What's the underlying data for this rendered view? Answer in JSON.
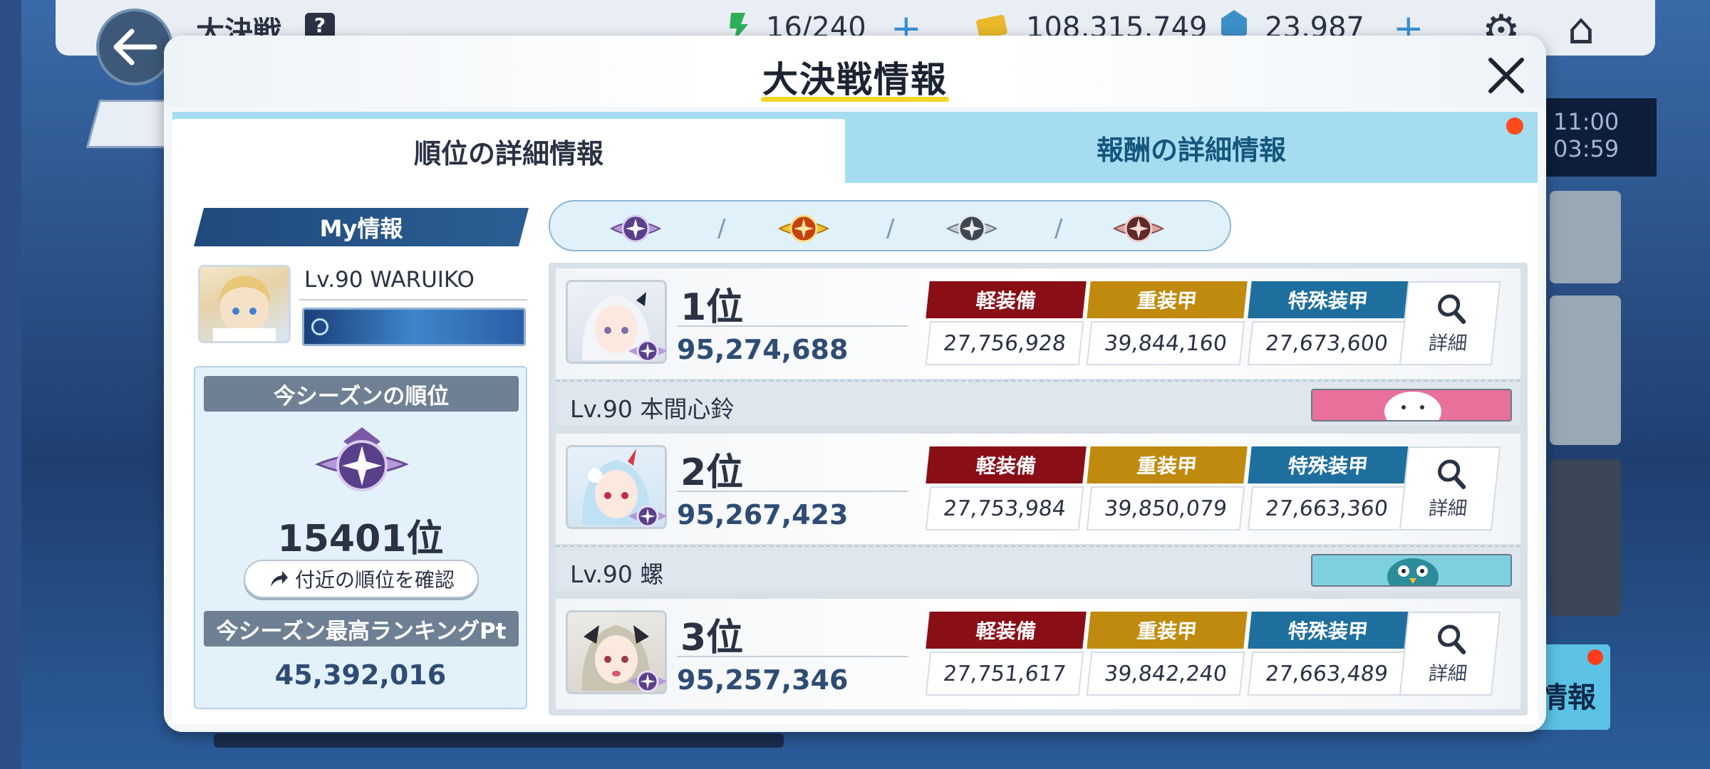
{
  "background": {
    "title": "大決戦",
    "help_label": "?",
    "stamina": "16/240",
    "credits": "108,315,749",
    "gems": "23,987",
    "side_label": "大",
    "timer_line1": "11:00",
    "timer_line2": "03:59",
    "info_label": "情報"
  },
  "modal": {
    "title": "大決戦情報",
    "tabs": {
      "rank": "順位の詳細情報",
      "reward": "報酬の詳細情報"
    }
  },
  "my_info": {
    "header": "My情報",
    "name": "Lv.90 WARUIKO",
    "season_title": "今シーズンの順位",
    "season_rank": "15401位",
    "nearby_button": "付近の順位を確認",
    "best_title": "今シーズン最高ランキングPt",
    "best_value": "45,392,016"
  },
  "armor_labels": {
    "light": "軽装備",
    "heavy": "重装甲",
    "special": "特殊装甲"
  },
  "detail_label": "詳細",
  "rankings": [
    {
      "position": "1位",
      "score": "95,274,688",
      "light": "27,756,928",
      "heavy": "39,844,160",
      "special": "27,673,600",
      "player": "Lv.90  本間心鈴",
      "banner_color": "#e8709a"
    },
    {
      "position": "2位",
      "score": "95,267,423",
      "light": "27,753,984",
      "heavy": "39,850,079",
      "special": "27,663,360",
      "player": "Lv.90  螺",
      "banner_color": "#7fd0df"
    },
    {
      "position": "3位",
      "score": "95,257,346",
      "light": "27,751,617",
      "heavy": "39,842,240",
      "special": "27,663,489",
      "player": "",
      "banner_color": "#c9d3dd"
    }
  ],
  "colors": {
    "accent_yellow": "#f4d62b",
    "tab_active": "#ffffff",
    "tab_inactive": "#a6dcef",
    "light_armor": "#8a0e16",
    "heavy_armor": "#c08a0e",
    "special_armor": "#1f6f9e"
  },
  "icons": {
    "close": "close-icon",
    "search": "magnifier-icon",
    "filter": [
      "purple-emblem-icon",
      "gold-emblem-icon",
      "silver-emblem-icon",
      "bronze-emblem-icon"
    ]
  }
}
